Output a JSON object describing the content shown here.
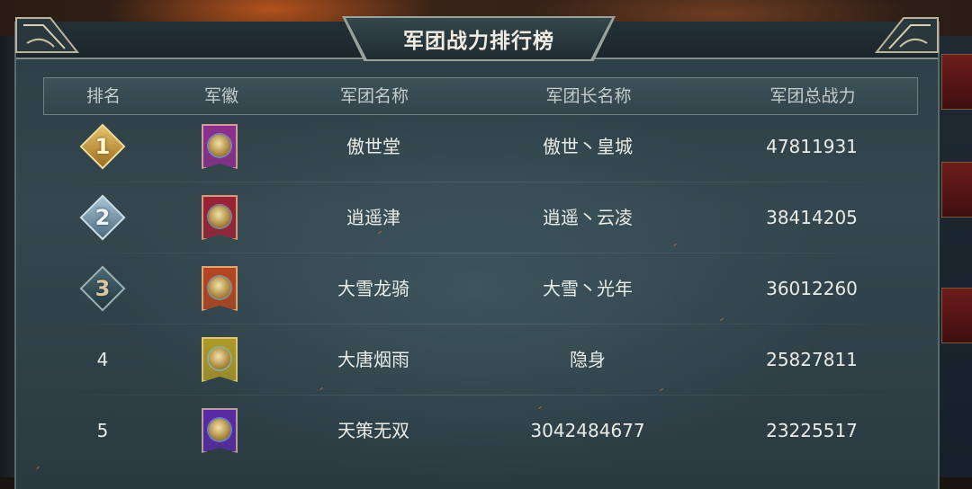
{
  "title": "军团战力排行榜",
  "columns": [
    "排名",
    "军徽",
    "军团名称",
    "军团长名称",
    "军团总战力"
  ],
  "rows": [
    {
      "rank": "1",
      "rank_style": "gold",
      "emblem_color": "#8e2f8f",
      "legion_name": "傲世堂",
      "leader_name": "傲世丶皇城",
      "power": "47811931"
    },
    {
      "rank": "2",
      "rank_style": "silver",
      "emblem_color": "#9b2236",
      "legion_name": "逍遥津",
      "leader_name": "逍遥丶云凌",
      "power": "38414205"
    },
    {
      "rank": "3",
      "rank_style": "bronze",
      "emblem_color": "#b64521",
      "legion_name": "大雪龙骑",
      "leader_name": "大雪丶光年",
      "power": "36012260"
    },
    {
      "rank": "4",
      "rank_style": "plain",
      "emblem_color": "#b09a2a",
      "legion_name": "大唐烟雨",
      "leader_name": "隐身",
      "power": "25827811"
    },
    {
      "rank": "5",
      "rank_style": "plain",
      "emblem_color": "#5a2aa6",
      "legion_name": "天策无双",
      "leader_name": "3042484677",
      "power": "23225517"
    }
  ],
  "colors": {
    "panel": "#34474e",
    "header_text": "#c4ccca",
    "title_text": "#f1ede2"
  }
}
